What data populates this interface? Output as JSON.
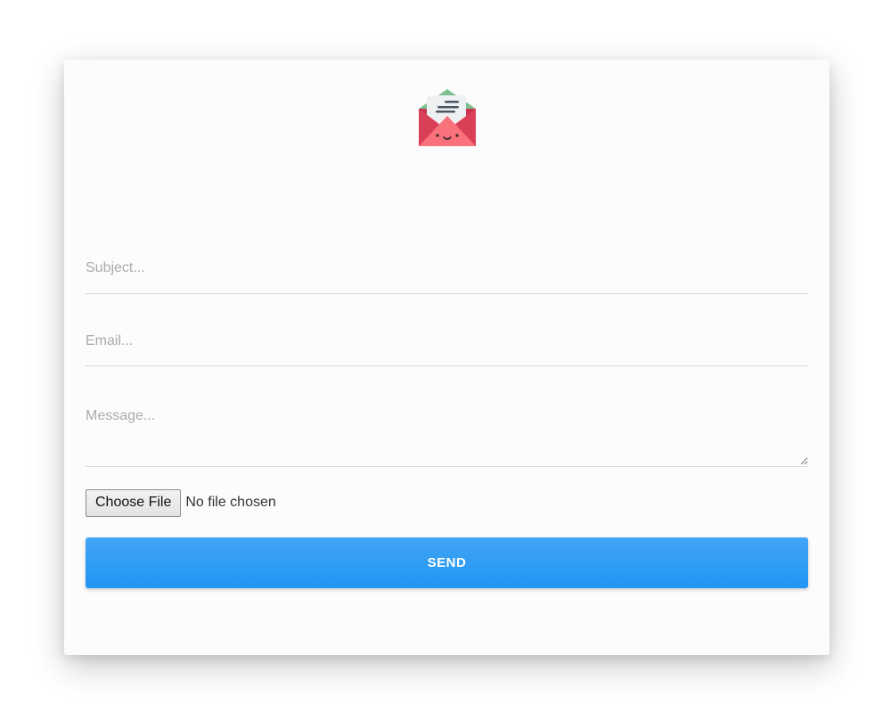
{
  "logo": {
    "icon": "envelope-letter-icon"
  },
  "form": {
    "subject_placeholder": "Subject...",
    "email_placeholder": "Email...",
    "message_placeholder": "Message...",
    "file_button_label": "Choose File",
    "file_status": "No file chosen",
    "send_label": "SEND"
  },
  "colors": {
    "accent": "#2196f3",
    "envelope_front": "#f9727b",
    "envelope_side": "#d94058",
    "envelope_flap": "#7cc08f"
  }
}
